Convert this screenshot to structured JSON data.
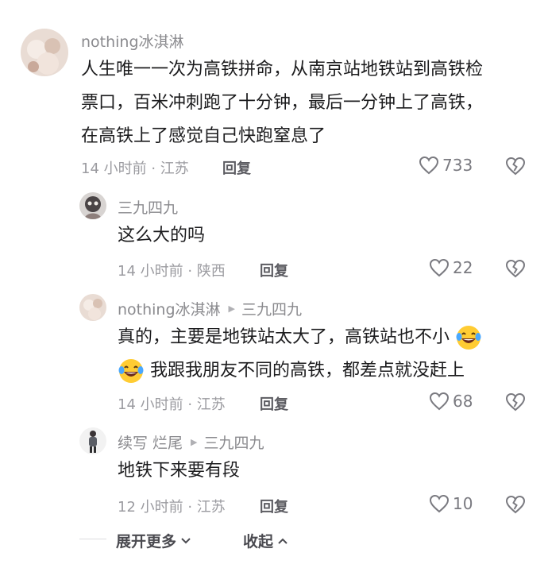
{
  "comments": [
    {
      "username": "nothing冰淇淋",
      "reply_to": "",
      "text_lines": [
        "人生唯一一次为高铁拼命，从南京站地铁站到高铁检",
        "票口，百米冲刺跑了十分钟，最后一分钟上了高铁，",
        "在高铁上了感觉自己快跑窒息了"
      ],
      "time_location": "14 小时前 · 江苏",
      "reply_label": "回复",
      "likes": "733"
    },
    {
      "username": "三九四九",
      "reply_to": "",
      "text_lines": [
        "这么大的吗"
      ],
      "time_location": "14 小时前 · 陕西",
      "reply_label": "回复",
      "likes": "22"
    },
    {
      "username": "nothing冰淇淋",
      "reply_to": "三九四九",
      "text_lines": [
        "真的，主要是地铁站太大了，高铁站也不小",
        "我跟我朋友不同的高铁，都差点就没赶上"
      ],
      "emoji": "laughing-tears",
      "time_location": "14 小时前 · 江苏",
      "reply_label": "回复",
      "likes": "68"
    },
    {
      "username": "续写 烂尾",
      "reply_to": "三九四九",
      "text_lines": [
        "地铁下来要有段"
      ],
      "time_location": "12 小时前 · 江苏",
      "reply_label": "回复",
      "likes": "10"
    }
  ],
  "footer": {
    "expand_label": "展开更多",
    "collapse_label": "收起"
  },
  "colors": {
    "text": "#1c1c1e",
    "meta": "#9b9ba0",
    "name": "#8a8a8e"
  },
  "icons": [
    "heart-outline-icon",
    "broken-heart-icon",
    "chevron-down-icon",
    "chevron-up-icon",
    "laughing-tears-emoji",
    "reply-arrow-icon"
  ]
}
